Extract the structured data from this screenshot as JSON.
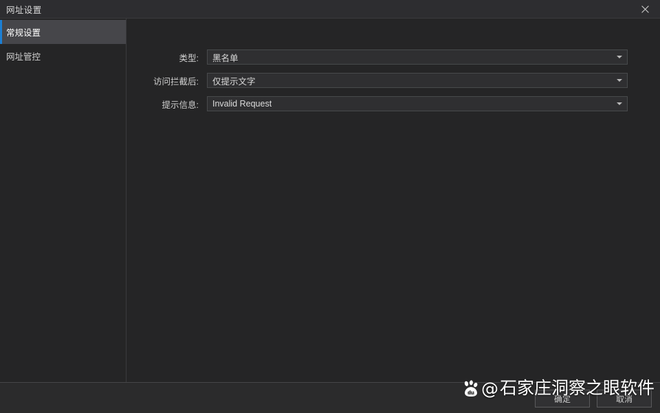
{
  "window": {
    "title": "网址设置",
    "close_icon": "close-icon"
  },
  "sidebar": {
    "items": [
      {
        "label": "常规设置",
        "active": true
      },
      {
        "label": "网址管控",
        "active": false
      }
    ]
  },
  "form": {
    "rows": [
      {
        "label": "类型:",
        "value": "黑名单",
        "name": "type",
        "arrow_icon": "chevron-down-icon"
      },
      {
        "label": "访问拦截后:",
        "value": "仅提示文字",
        "name": "after-block",
        "arrow_icon": "chevron-down-icon"
      },
      {
        "label": "提示信息:",
        "value": "Invalid Request",
        "name": "tip-message",
        "arrow_icon": "chevron-down-icon"
      }
    ]
  },
  "footer": {
    "ok_label": "确定",
    "cancel_label": "取消"
  },
  "watermark": {
    "logo_icon": "baidu-paw-icon",
    "logo_text": "du",
    "at_symbol": "@",
    "text": "石家庄洞察之眼软件"
  },
  "colors": {
    "accent": "#1c7fd4",
    "window_bg": "#252526",
    "titlebar_bg": "#2d2d30",
    "sidebar_active_bg": "#46464a",
    "field_bg": "#2f2f31",
    "field_border": "#484a4c",
    "footer_bg": "#2b2b2c",
    "text": "#cfcfcf"
  }
}
